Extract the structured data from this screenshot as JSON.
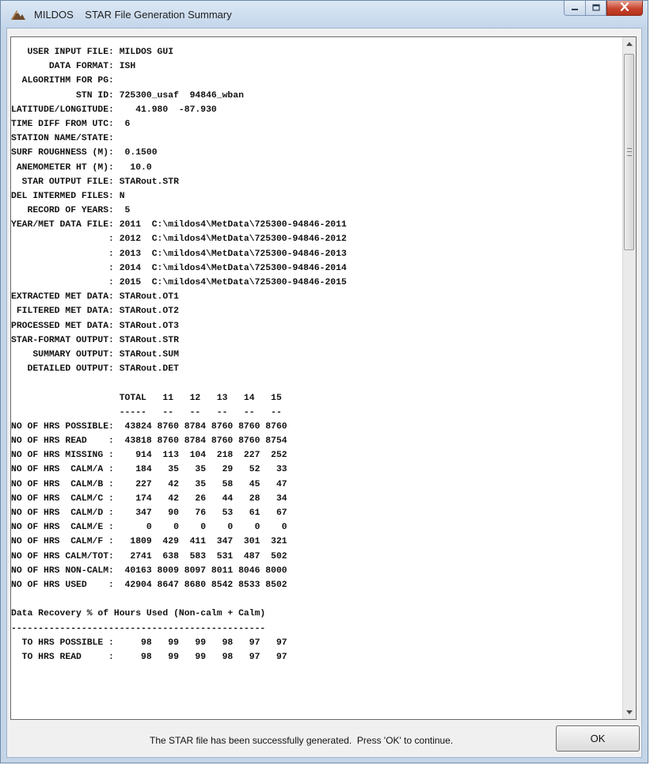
{
  "window": {
    "title": "MILDOS    STAR File Generation Summary",
    "icon": "mildos-app-icon",
    "buttons": {
      "minimize": "minimize-icon",
      "maximize": "maximize-icon",
      "close": "close-icon"
    }
  },
  "output": {
    "lines": [
      "   USER INPUT FILE: MILDOS GUI",
      "       DATA FORMAT: ISH",
      "  ALGORITHM FOR PG:",
      "            STN ID: 725300_usaf  94846_wban",
      "LATITUDE/LONGITUDE:    41.980  -87.930",
      "TIME DIFF FROM UTC:  6",
      "STATION NAME/STATE:",
      "SURF ROUGHNESS (M):  0.1500",
      " ANEMOMETER HT (M):   10.0",
      "  STAR OUTPUT FILE: STARout.STR",
      "DEL INTERMED FILES: N",
      "   RECORD OF YEARS:  5",
      "YEAR/MET DATA FILE: 2011  C:\\mildos4\\MetData\\725300-94846-2011",
      "                  : 2012  C:\\mildos4\\MetData\\725300-94846-2012",
      "                  : 2013  C:\\mildos4\\MetData\\725300-94846-2013",
      "                  : 2014  C:\\mildos4\\MetData\\725300-94846-2014",
      "                  : 2015  C:\\mildos4\\MetData\\725300-94846-2015",
      "EXTRACTED MET DATA: STARout.OT1",
      " FILTERED MET DATA: STARout.OT2",
      "PROCESSED MET DATA: STARout.OT3",
      "STAR-FORMAT OUTPUT: STARout.STR",
      "    SUMMARY OUTPUT: STARout.SUM",
      "   DETAILED OUTPUT: STARout.DET",
      "",
      "                    TOTAL   11   12   13   14   15",
      "                    -----   --   --   --   --   --",
      "NO OF HRS POSSIBLE:  43824 8760 8784 8760 8760 8760",
      "NO OF HRS READ    :  43818 8760 8784 8760 8760 8754",
      "NO OF HRS MISSING :    914  113  104  218  227  252",
      "NO OF HRS  CALM/A :    184   35   35   29   52   33",
      "NO OF HRS  CALM/B :    227   42   35   58   45   47",
      "NO OF HRS  CALM/C :    174   42   26   44   28   34",
      "NO OF HRS  CALM/D :    347   90   76   53   61   67",
      "NO OF HRS  CALM/E :      0    0    0    0    0    0",
      "NO OF HRS  CALM/F :   1809  429  411  347  301  321",
      "NO OF HRS CALM/TOT:   2741  638  583  531  487  502",
      "NO OF HRS NON-CALM:  40163 8009 8097 8011 8046 8000",
      "NO OF HRS USED    :  42904 8647 8680 8542 8533 8502",
      "",
      "Data Recovery % of Hours Used (Non-calm + Calm)",
      "-----------------------------------------------",
      "  TO HRS POSSIBLE :     98   99   99   98   97   97",
      "  TO HRS READ     :     98   99   99   98   97   97"
    ]
  },
  "footer": {
    "message": "The STAR file has been successfully generated.  Press 'OK' to continue.",
    "ok_label": "OK"
  }
}
